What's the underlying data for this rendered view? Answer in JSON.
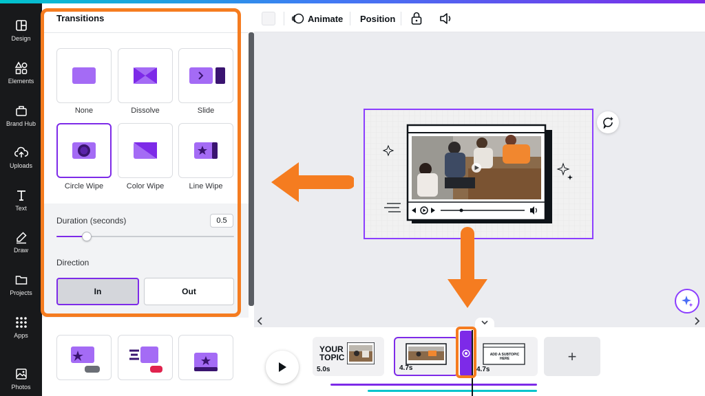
{
  "sidebar": {
    "items": [
      {
        "label": "Design",
        "icon": "design-icon"
      },
      {
        "label": "Elements",
        "icon": "elements-icon"
      },
      {
        "label": "Brand Hub",
        "icon": "brand-hub-icon"
      },
      {
        "label": "Uploads",
        "icon": "uploads-icon"
      },
      {
        "label": "Text",
        "icon": "text-icon"
      },
      {
        "label": "Draw",
        "icon": "draw-icon"
      },
      {
        "label": "Projects",
        "icon": "projects-icon"
      },
      {
        "label": "Apps",
        "icon": "apps-icon"
      },
      {
        "label": "Photos",
        "icon": "photos-icon"
      }
    ]
  },
  "panel": {
    "title": "Transitions",
    "transitions": [
      {
        "label": "None"
      },
      {
        "label": "Dissolve"
      },
      {
        "label": "Slide"
      },
      {
        "label": "Circle Wipe",
        "selected": true
      },
      {
        "label": "Color Wipe"
      },
      {
        "label": "Line Wipe"
      }
    ],
    "duration_label": "Duration (seconds)",
    "duration_value": "0.5",
    "duration_fraction": 0.17,
    "direction_label": "Direction",
    "direction_in": "In",
    "direction_out": "Out",
    "direction_selected": "In"
  },
  "toolbar": {
    "animate": "Animate",
    "position": "Position"
  },
  "timeline": {
    "clips": [
      {
        "duration": "5.0s",
        "thumb_text_1": "YOUR",
        "thumb_text_2": "TOPIC"
      },
      {
        "duration": "4.7s",
        "selected": true
      },
      {
        "duration": "4.7s",
        "thumb_text_1": "ADD A SUBTOPIC HERE"
      }
    ],
    "add_label": "+"
  },
  "colors": {
    "accent": "#7d2ae8",
    "annotation": "#f57c20",
    "rail_bg": "#18191b"
  }
}
